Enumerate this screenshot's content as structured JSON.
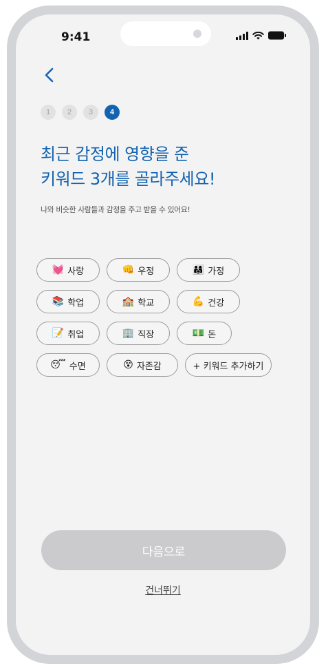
{
  "status_bar": {
    "time": "9:41"
  },
  "icons": {
    "back": "chevron-left-icon",
    "signal": "cellular-signal-icon",
    "wifi": "wifi-icon",
    "battery": "battery-icon"
  },
  "steps": [
    "1",
    "2",
    "3",
    "4"
  ],
  "current_step": 4,
  "title_line1": "최근 감정에 영향을 준",
  "title_line2": "키워드 3개를 골라주세요!",
  "subtitle": "나와 비슷한 사람들과 감정을 주고 받을 수 있어요!",
  "keywords": [
    {
      "emoji": "💓",
      "label": "사랑"
    },
    {
      "emoji": "👊",
      "label": "우정"
    },
    {
      "emoji": "👨‍👩‍👧",
      "label": "가정"
    },
    {
      "emoji": "📚",
      "label": "학업"
    },
    {
      "emoji": "🏫",
      "label": "학교"
    },
    {
      "emoji": "💪",
      "label": "건강"
    },
    {
      "emoji": "📝",
      "label": "취업"
    },
    {
      "emoji": "🏢",
      "label": "직장"
    },
    {
      "emoji": "💵",
      "label": "돈"
    },
    {
      "emoji": "😴",
      "label": "수면"
    },
    {
      "emoji": "😵",
      "label": "자존감"
    }
  ],
  "add_keyword_label": "+ 키워드 추가하기",
  "next_button_label": "다음으로",
  "skip_label": "건너뛰기",
  "colors": {
    "accent": "#1463b0",
    "background": "#f3f3f3",
    "disabled_button": "#cbcbcd"
  }
}
